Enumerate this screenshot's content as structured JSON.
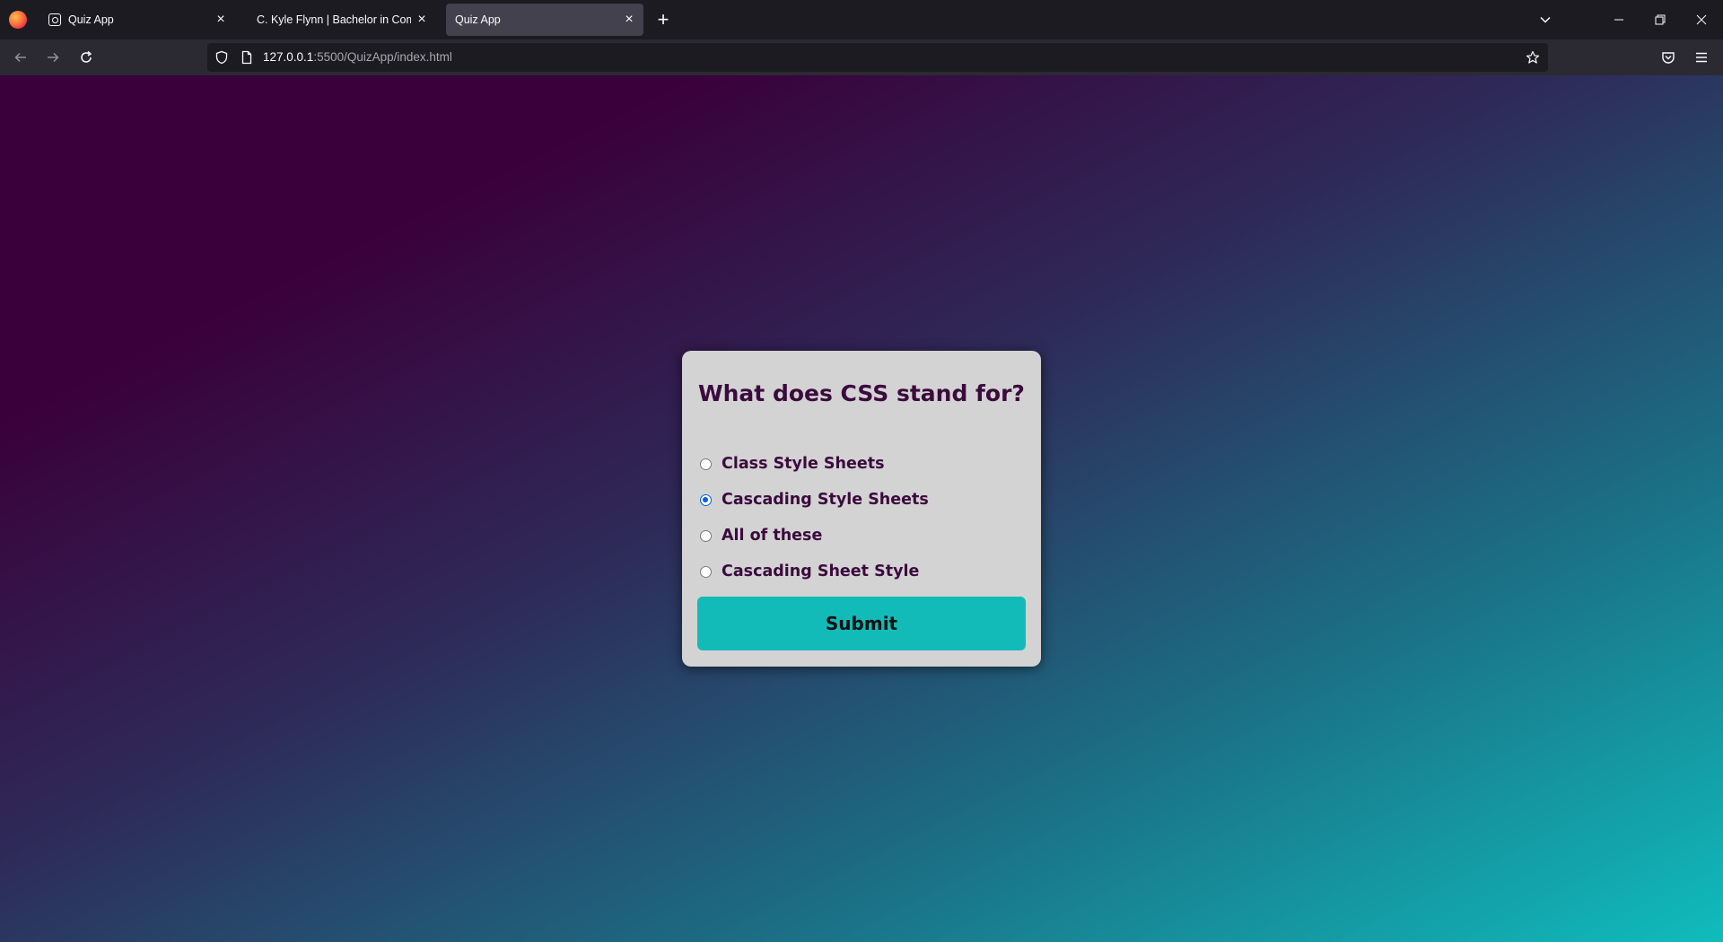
{
  "browser": {
    "tabs": [
      {
        "title": "Quiz App",
        "active": false
      },
      {
        "title": "C. Kyle Flynn | Bachelor in Computer",
        "active": false
      },
      {
        "title": "Quiz App",
        "active": true
      }
    ],
    "close_label": "×",
    "new_tab_label": "+",
    "url_host": "127.0.0.1",
    "url_rest": ":5500/QuizApp/index.html",
    "colors": {
      "tabbar": "#1c1b22",
      "toolbar": "#2b2a33",
      "active_tab": "#42414d"
    }
  },
  "quiz": {
    "question": "What does CSS stand for?",
    "answers": [
      {
        "label": "Class Style Sheets",
        "selected": false
      },
      {
        "label": "Cascading Style Sheets",
        "selected": true
      },
      {
        "label": "All of these",
        "selected": false
      },
      {
        "label": "Cascading Sheet Style",
        "selected": false
      }
    ],
    "submit_label": "Submit",
    "colors": {
      "card": "#d3d3d3",
      "text": "#3b0b3d",
      "button": "#12bbb8",
      "radio_checked": "#0060df"
    }
  }
}
